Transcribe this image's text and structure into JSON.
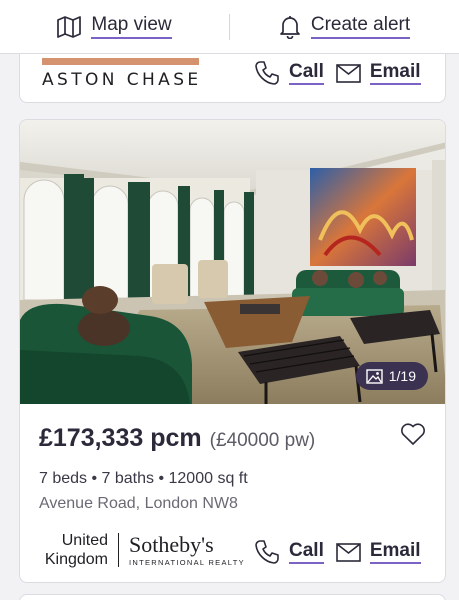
{
  "topbar": {
    "map_view_label": "Map view",
    "create_alert_label": "Create alert",
    "map_icon": "map-icon",
    "bell_icon": "bell-icon"
  },
  "listing_prev": {
    "agent_logo_text": "ASTON CHASE",
    "call_label": "Call",
    "email_label": "Email"
  },
  "listing": {
    "photo_counter": "1/19",
    "price": "£173,333 pcm",
    "price_weekly": "(£40000 pw)",
    "specs": "7 beds • 7 baths • 12000 sq ft",
    "address": "Avenue Road, London NW8",
    "agent_region_line1": "United",
    "agent_region_line2": "Kingdom",
    "agent_name": "Sotheby's",
    "agent_subtitle": "INTERNATIONAL REALTY",
    "call_label": "Call",
    "email_label": "Email"
  },
  "colors": {
    "accent": "#7b63c6",
    "text": "#2b2a3a",
    "badge_bg": "#3b3150",
    "aston_bar": "#d4926f"
  }
}
